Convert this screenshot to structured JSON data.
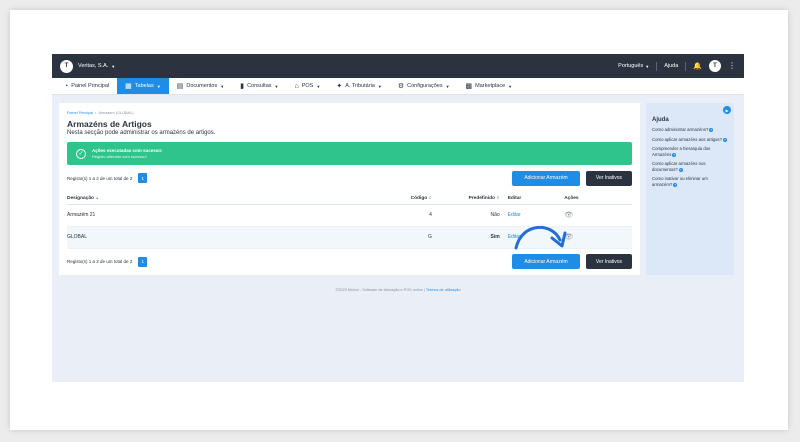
{
  "topbar": {
    "logo": "T",
    "company": "Veritas, S.A.",
    "language": "Português",
    "help": "Ajuda",
    "avatar": "T"
  },
  "nav": [
    {
      "label": "Painel Principal",
      "icon": "dashboard-icon",
      "active": false
    },
    {
      "label": "Tabelas",
      "icon": "table-icon",
      "active": true
    },
    {
      "label": "Documentos",
      "icon": "document-icon",
      "active": false
    },
    {
      "label": "Consultas",
      "icon": "chart-icon",
      "active": false
    },
    {
      "label": "POS",
      "icon": "pos-icon",
      "active": false
    },
    {
      "label": "A. Tributária",
      "icon": "tax-icon",
      "active": false
    },
    {
      "label": "Configurações",
      "icon": "settings-icon",
      "active": false
    },
    {
      "label": "Marketplace",
      "icon": "marketplace-icon",
      "active": false
    }
  ],
  "breadcrumb": {
    "root": "Painel Principal",
    "sep": "›",
    "current": "Armazém (GLOBAL)"
  },
  "page": {
    "title": "Armazéns de Artigos",
    "subtitle": "Nesta secção pode administrar os armazéns de artigos."
  },
  "alert": {
    "title": "Ações executadas com sucesso:",
    "message": "Registo alterado com sucesso!"
  },
  "pager": {
    "text": "Registo(s) 1 a 2 de um total de 2",
    "page": "1"
  },
  "buttons": {
    "add": "Adicionar Armazém",
    "inactive": "Ver Inativos"
  },
  "table": {
    "headers": {
      "name": "Designação",
      "code": "Código",
      "default": "Predefinido",
      "edit": "Editar",
      "actions": "Ações"
    },
    "rows": [
      {
        "name": "Armazém 21",
        "code": "4",
        "default": "Não",
        "edit": "Editar"
      },
      {
        "name": "GLOBAL",
        "code": "G",
        "default": "Sim",
        "edit": "Editar"
      }
    ]
  },
  "help": {
    "title": "Ajuda",
    "items": [
      "Como administrar armazéns?",
      "Como aplicar armazéns aos artigos?",
      "Compreender a hierarquia dos Armazéns",
      "Como aplicar armazéns nos documentos?",
      "Como inativar ou eliminar um armazém?"
    ]
  },
  "footer": {
    "text": "©2023 Moloni - Software de faturação e POS online",
    "link": "Termos de utilização"
  },
  "colors": {
    "primary": "#1f8ce6",
    "dark": "#2b3340",
    "success": "#2ec48c",
    "help_bg": "#dce8f7"
  }
}
